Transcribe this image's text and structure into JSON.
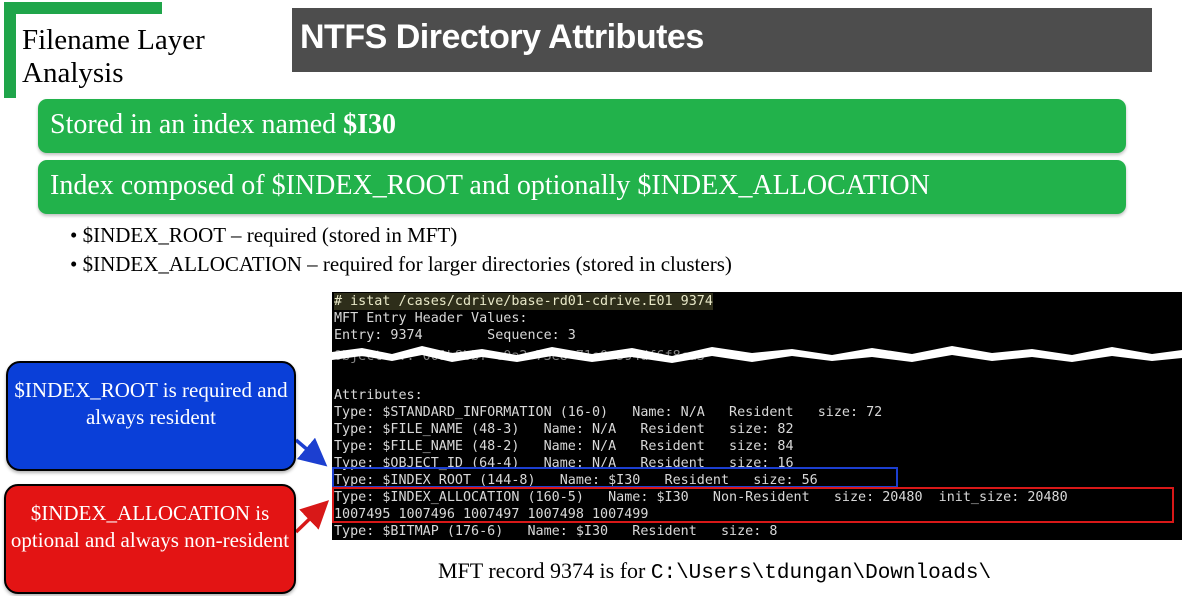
{
  "section_label": [
    "Filename Layer",
    "Analysis"
  ],
  "title": "NTFS Directory Attributes",
  "boxes": {
    "one": {
      "prefix": "Stored in an index named ",
      "bold": "$I30"
    },
    "two": "Index composed of $INDEX_ROOT and optionally $INDEX_ALLOCATION"
  },
  "bullets": [
    "$INDEX_ROOT – required (stored in MFT)",
    "$INDEX_ALLOCATION – required for larger directories (stored in clusters)"
  ],
  "terminal": {
    "lines": [
      "# istat /cases/cdrive/base-rd01-cdrive.E01 9374",
      "MFT Entry Header Values:",
      "Entry: 9374        Sequence: 3",
      "Object ... 001b8bbf-c0a2-73e8-71e0-594df6f8ca3",
      "",
      "Attributes:",
      "Type: $STANDARD_INFORMATION (16-0)   Name: N/A   Resident   size: 72",
      "Type: $FILE_NAME (48-3)   Name: N/A   Resident   size: 82",
      "Type: $FILE_NAME (48-2)   Name: N/A   Resident   size: 84",
      "Type: $OBJECT_ID (64-4)   Name: N/A   Resident   size: 16",
      "Type: $INDEX_ROOT (144-8)   Name: $I30   Resident   size: 56",
      "Type: $INDEX_ALLOCATION (160-5)   Name: $I30   Non-Resident   size: 20480  init_size: 20480",
      "1007495 1007496 1007497 1007498 1007499",
      "Type: $BITMAP (176-6)   Name: $I30   Resident   size: 8"
    ]
  },
  "callouts": {
    "blue": "$INDEX_ROOT is required and always resident",
    "red": "$INDEX_ALLOCATION is optional and always non-resident"
  },
  "caption": {
    "text": "MFT record 9374 is for ",
    "path": "C:\\Users\\tdungan\\Downloads\\"
  },
  "colors": {
    "green": "#22b24b",
    "title_bg": "#4d4d4d",
    "blue": "#0a3fd8",
    "red": "#e31414"
  }
}
